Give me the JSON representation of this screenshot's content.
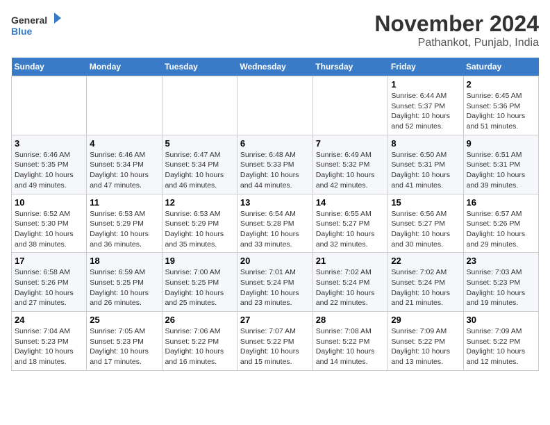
{
  "logo": {
    "text_general": "General",
    "text_blue": "Blue"
  },
  "title": "November 2024",
  "subtitle": "Pathankot, Punjab, India",
  "days_of_week": [
    "Sunday",
    "Monday",
    "Tuesday",
    "Wednesday",
    "Thursday",
    "Friday",
    "Saturday"
  ],
  "weeks": [
    [
      {
        "day": "",
        "info": ""
      },
      {
        "day": "",
        "info": ""
      },
      {
        "day": "",
        "info": ""
      },
      {
        "day": "",
        "info": ""
      },
      {
        "day": "",
        "info": ""
      },
      {
        "day": "1",
        "info": "Sunrise: 6:44 AM\nSunset: 5:37 PM\nDaylight: 10 hours and 52 minutes."
      },
      {
        "day": "2",
        "info": "Sunrise: 6:45 AM\nSunset: 5:36 PM\nDaylight: 10 hours and 51 minutes."
      }
    ],
    [
      {
        "day": "3",
        "info": "Sunrise: 6:46 AM\nSunset: 5:35 PM\nDaylight: 10 hours and 49 minutes."
      },
      {
        "day": "4",
        "info": "Sunrise: 6:46 AM\nSunset: 5:34 PM\nDaylight: 10 hours and 47 minutes."
      },
      {
        "day": "5",
        "info": "Sunrise: 6:47 AM\nSunset: 5:34 PM\nDaylight: 10 hours and 46 minutes."
      },
      {
        "day": "6",
        "info": "Sunrise: 6:48 AM\nSunset: 5:33 PM\nDaylight: 10 hours and 44 minutes."
      },
      {
        "day": "7",
        "info": "Sunrise: 6:49 AM\nSunset: 5:32 PM\nDaylight: 10 hours and 42 minutes."
      },
      {
        "day": "8",
        "info": "Sunrise: 6:50 AM\nSunset: 5:31 PM\nDaylight: 10 hours and 41 minutes."
      },
      {
        "day": "9",
        "info": "Sunrise: 6:51 AM\nSunset: 5:31 PM\nDaylight: 10 hours and 39 minutes."
      }
    ],
    [
      {
        "day": "10",
        "info": "Sunrise: 6:52 AM\nSunset: 5:30 PM\nDaylight: 10 hours and 38 minutes."
      },
      {
        "day": "11",
        "info": "Sunrise: 6:53 AM\nSunset: 5:29 PM\nDaylight: 10 hours and 36 minutes."
      },
      {
        "day": "12",
        "info": "Sunrise: 6:53 AM\nSunset: 5:29 PM\nDaylight: 10 hours and 35 minutes."
      },
      {
        "day": "13",
        "info": "Sunrise: 6:54 AM\nSunset: 5:28 PM\nDaylight: 10 hours and 33 minutes."
      },
      {
        "day": "14",
        "info": "Sunrise: 6:55 AM\nSunset: 5:27 PM\nDaylight: 10 hours and 32 minutes."
      },
      {
        "day": "15",
        "info": "Sunrise: 6:56 AM\nSunset: 5:27 PM\nDaylight: 10 hours and 30 minutes."
      },
      {
        "day": "16",
        "info": "Sunrise: 6:57 AM\nSunset: 5:26 PM\nDaylight: 10 hours and 29 minutes."
      }
    ],
    [
      {
        "day": "17",
        "info": "Sunrise: 6:58 AM\nSunset: 5:26 PM\nDaylight: 10 hours and 27 minutes."
      },
      {
        "day": "18",
        "info": "Sunrise: 6:59 AM\nSunset: 5:25 PM\nDaylight: 10 hours and 26 minutes."
      },
      {
        "day": "19",
        "info": "Sunrise: 7:00 AM\nSunset: 5:25 PM\nDaylight: 10 hours and 25 minutes."
      },
      {
        "day": "20",
        "info": "Sunrise: 7:01 AM\nSunset: 5:24 PM\nDaylight: 10 hours and 23 minutes."
      },
      {
        "day": "21",
        "info": "Sunrise: 7:02 AM\nSunset: 5:24 PM\nDaylight: 10 hours and 22 minutes."
      },
      {
        "day": "22",
        "info": "Sunrise: 7:02 AM\nSunset: 5:24 PM\nDaylight: 10 hours and 21 minutes."
      },
      {
        "day": "23",
        "info": "Sunrise: 7:03 AM\nSunset: 5:23 PM\nDaylight: 10 hours and 19 minutes."
      }
    ],
    [
      {
        "day": "24",
        "info": "Sunrise: 7:04 AM\nSunset: 5:23 PM\nDaylight: 10 hours and 18 minutes."
      },
      {
        "day": "25",
        "info": "Sunrise: 7:05 AM\nSunset: 5:23 PM\nDaylight: 10 hours and 17 minutes."
      },
      {
        "day": "26",
        "info": "Sunrise: 7:06 AM\nSunset: 5:22 PM\nDaylight: 10 hours and 16 minutes."
      },
      {
        "day": "27",
        "info": "Sunrise: 7:07 AM\nSunset: 5:22 PM\nDaylight: 10 hours and 15 minutes."
      },
      {
        "day": "28",
        "info": "Sunrise: 7:08 AM\nSunset: 5:22 PM\nDaylight: 10 hours and 14 minutes."
      },
      {
        "day": "29",
        "info": "Sunrise: 7:09 AM\nSunset: 5:22 PM\nDaylight: 10 hours and 13 minutes."
      },
      {
        "day": "30",
        "info": "Sunrise: 7:09 AM\nSunset: 5:22 PM\nDaylight: 10 hours and 12 minutes."
      }
    ]
  ]
}
